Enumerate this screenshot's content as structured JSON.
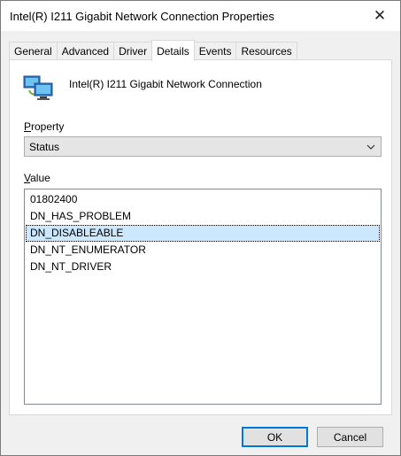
{
  "window": {
    "title": "Intel(R) I211 Gigabit Network Connection Properties",
    "close_glyph": "✕"
  },
  "tabs": [
    {
      "label": "General",
      "active": false
    },
    {
      "label": "Advanced",
      "active": false
    },
    {
      "label": "Driver",
      "active": false
    },
    {
      "label": "Details",
      "active": true
    },
    {
      "label": "Events",
      "active": false
    },
    {
      "label": "Resources",
      "active": false
    }
  ],
  "device": {
    "icon": "network-adapter-icon",
    "name": "Intel(R) I211 Gigabit Network Connection"
  },
  "property": {
    "label_accel": "P",
    "label_rest": "roperty",
    "selected": "Status"
  },
  "value": {
    "label_accel": "V",
    "label_rest": "alue",
    "items": [
      {
        "text": "01802400",
        "selected": false
      },
      {
        "text": "DN_HAS_PROBLEM",
        "selected": false
      },
      {
        "text": "DN_DISABLEABLE",
        "selected": true
      },
      {
        "text": "DN_NT_ENUMERATOR",
        "selected": false
      },
      {
        "text": "DN_NT_DRIVER",
        "selected": false
      }
    ]
  },
  "buttons": {
    "ok": "OK",
    "cancel": "Cancel"
  },
  "colors": {
    "selection": "#cce8ff",
    "default_button_border": "#0078d7"
  }
}
